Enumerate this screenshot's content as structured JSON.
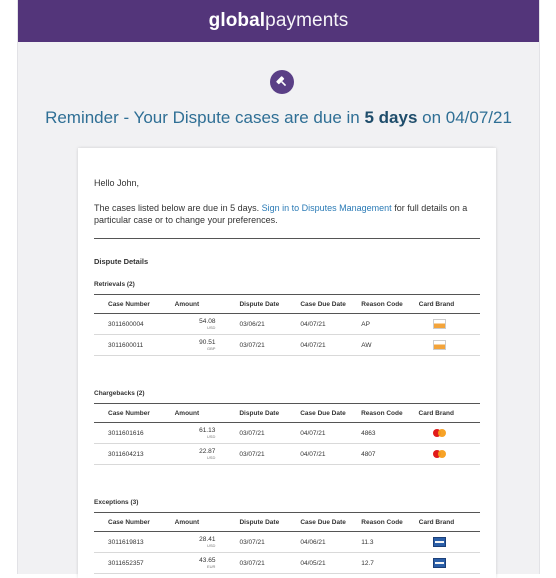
{
  "brand": {
    "logo_bold": "global",
    "logo_light": "payments"
  },
  "headline": {
    "prefix": "Reminder - Your Dispute cases are due in ",
    "strong": "5 days",
    "suffix": " on 04/07/21"
  },
  "greeting": "Hello John,",
  "intro": {
    "before_link": "The cases listed below are due in 5 days. ",
    "link": "Sign in to Disputes Management",
    "after_link": " for full details on a particular case or to change your preferences."
  },
  "section_title": "Dispute Details",
  "columns": [
    "Case Number",
    "Amount",
    "Dispute Date",
    "Case Due Date",
    "Reason Code",
    "Card Brand"
  ],
  "sections": [
    {
      "title": "Retrievals (2)",
      "rows": [
        {
          "case": "3011600004",
          "amount": "54.08",
          "currency": "USD",
          "dispute_date": "03/06/21",
          "due_date": "04/07/21",
          "reason": "AP",
          "brand": "maestro"
        },
        {
          "case": "3011600011",
          "amount": "90.51",
          "currency": "GBP",
          "dispute_date": "03/07/21",
          "due_date": "04/07/21",
          "reason": "AW",
          "brand": "maestro"
        }
      ]
    },
    {
      "title": "Chargebacks (2)",
      "rows": [
        {
          "case": "3011601616",
          "amount": "61.13",
          "currency": "USD",
          "dispute_date": "03/07/21",
          "due_date": "04/07/21",
          "reason": "4863",
          "brand": "mastercard"
        },
        {
          "case": "3011604213",
          "amount": "22.87",
          "currency": "USD",
          "dispute_date": "03/07/21",
          "due_date": "04/07/21",
          "reason": "4807",
          "brand": "mastercard"
        }
      ]
    },
    {
      "title": "Exceptions (3)",
      "rows": [
        {
          "case": "3011619813",
          "amount": "28.41",
          "currency": "USD",
          "dispute_date": "03/07/21",
          "due_date": "04/06/21",
          "reason": "11.3",
          "brand": "visa"
        },
        {
          "case": "3011652357",
          "amount": "43.65",
          "currency": "EUR",
          "dispute_date": "03/07/21",
          "due_date": "04/05/21",
          "reason": "12.7",
          "brand": "visa"
        }
      ]
    }
  ],
  "colors": {
    "banner": "#53357a",
    "headline": "#2f6f95",
    "link": "#2b7bb6"
  },
  "icons": {
    "hero": "gavel-icon"
  }
}
